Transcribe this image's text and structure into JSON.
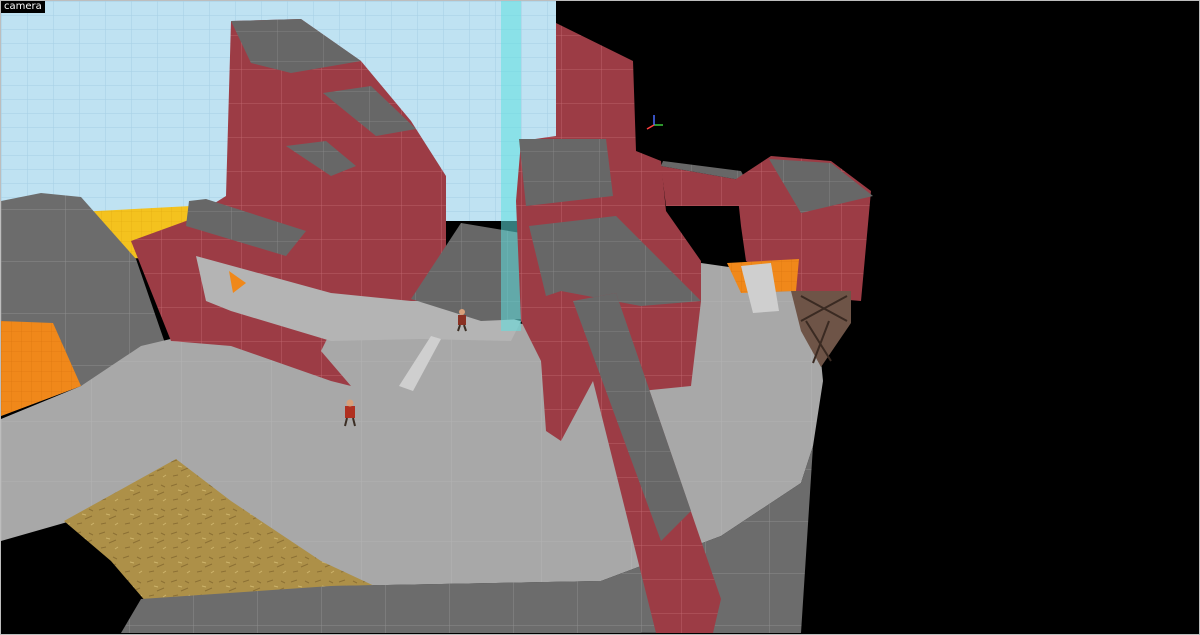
{
  "viewport": {
    "label": "camera",
    "view_mode": "3d-textured",
    "colors": {
      "void": "#000000",
      "sky": "#b9dff0",
      "red_wall": "#9a3b44",
      "roof": "#6a6a6a",
      "floor": "#a9a9a9",
      "cliff": "#6d6d6d",
      "orange": "#f0881a",
      "yellow": "#f4c21e",
      "sand": "#b09349",
      "selection": "#5fe0e0"
    }
  }
}
